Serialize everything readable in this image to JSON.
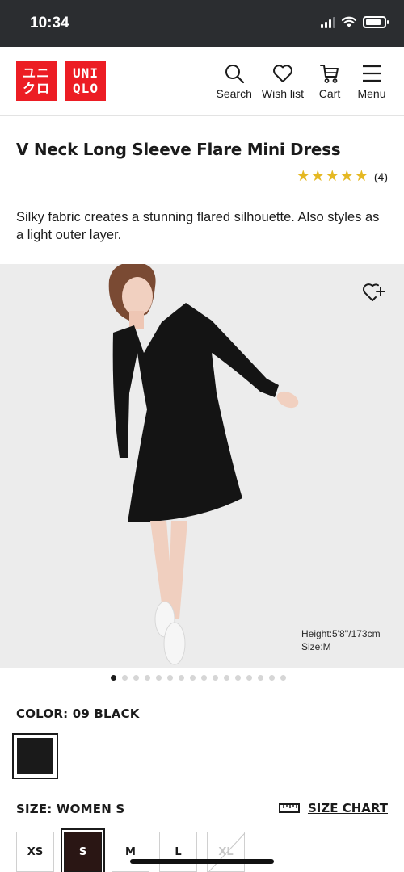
{
  "status_bar": {
    "time": "10:34",
    "battery_level": 0.85
  },
  "header": {
    "logo": {
      "left": [
        "ユニ",
        "クロ"
      ],
      "right": [
        "UNI",
        "QLO"
      ]
    },
    "nav": [
      {
        "label": "Search",
        "icon": "search-icon"
      },
      {
        "label": "Wish list",
        "icon": "heart-icon"
      },
      {
        "label": "Cart",
        "icon": "cart-icon"
      },
      {
        "label": "Menu",
        "icon": "menu-icon"
      }
    ]
  },
  "product": {
    "title": "V Neck Long Sleeve Flare Mini Dress",
    "rating_stars": 5,
    "rating_count": "(4)",
    "description": "Silky fabric creates a stunning flared silhouette. Also styles as a light outer layer."
  },
  "gallery": {
    "model_height": "Height:5'8''/173cm",
    "model_size": "Size:M",
    "dot_count": 16,
    "active_dot": 0
  },
  "color": {
    "label": "COLOR: 09 BLACK",
    "swatch_color": "#1a1a1a"
  },
  "size": {
    "label": "SIZE: WOMEN S",
    "chart_label": "SIZE CHART",
    "options": [
      {
        "label": "XS",
        "state": "available"
      },
      {
        "label": "S",
        "state": "selected"
      },
      {
        "label": "M",
        "state": "available"
      },
      {
        "label": "L",
        "state": "available"
      },
      {
        "label": "XL",
        "state": "unavailable"
      }
    ]
  },
  "colors": {
    "brand": "#ec1d24",
    "star": "#e5b822",
    "selected_size": "#2a1614"
  }
}
